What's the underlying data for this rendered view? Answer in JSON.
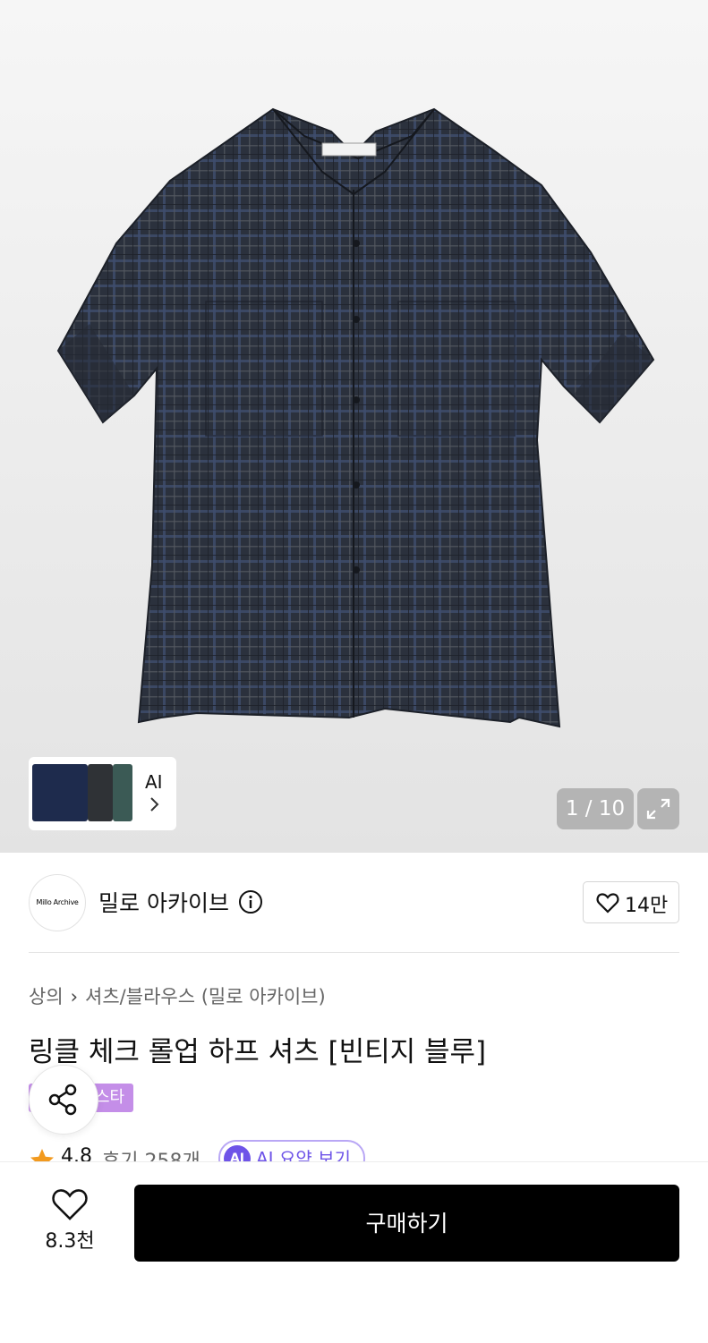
{
  "gallery": {
    "counter": "1 / 10",
    "thumbnail_label": "AI",
    "colors": {
      "shirt": "#2e3440",
      "check": "#4a5a7a"
    }
  },
  "brand": {
    "logo_text": "Millo Archive",
    "name": "밀로 아카이브",
    "like_count": "14만"
  },
  "breadcrumb": [
    "상의",
    "셔츠/블라우스 (밀로 아카이브)"
  ],
  "product": {
    "title": "링클 체크 롤업 하프 셔츠 [빈티지 블루]",
    "badge": "스타",
    "rating": "4.8",
    "reviews": "후기 258개",
    "ai_summary_icon": "AI",
    "ai_summary_label": "AI 요약 보기"
  },
  "bottom": {
    "wish_count": "8.3천",
    "buy_label": "구매하기"
  },
  "icons": [
    "share-icon",
    "heart-icon",
    "info-icon",
    "expand-icon",
    "star-icon",
    "chevron-right-icon"
  ],
  "accent_colors": {
    "badge": "#c48ee8",
    "ai": "#6e54e8",
    "star": "#f29a1f"
  }
}
